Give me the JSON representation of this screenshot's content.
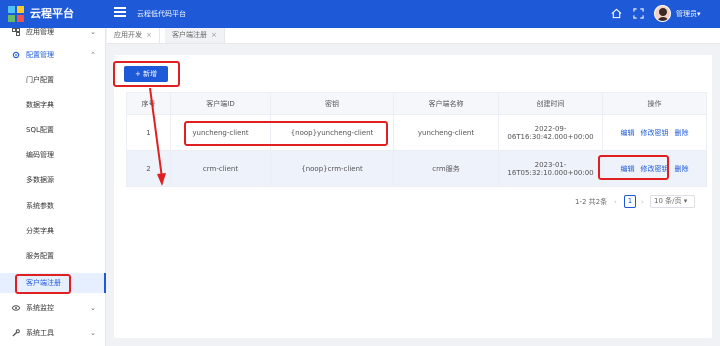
{
  "header": {
    "brand": "云程平台",
    "subtitle": "云程低代码平台",
    "user": "管理员▾",
    "accent_color": "#1e59d8"
  },
  "sidebar": {
    "items": [
      {
        "label": "应用管理",
        "icon": "app-icon",
        "chevron": "⌄"
      },
      {
        "label": "配置管理",
        "icon": "gear-icon",
        "chevron": "⌃"
      },
      {
        "label": "门户配置"
      },
      {
        "label": "数据字典"
      },
      {
        "label": "SQL配置"
      },
      {
        "label": "编码管理"
      },
      {
        "label": "多数据源"
      },
      {
        "label": "系统参数"
      },
      {
        "label": "分类字典"
      },
      {
        "label": "服务配置"
      },
      {
        "label": "客户端注册"
      },
      {
        "label": "系统监控",
        "icon": "eye-icon",
        "chevron": "⌄"
      },
      {
        "label": "系统工具",
        "icon": "wrench-icon",
        "chevron": "⌄"
      }
    ]
  },
  "tabs": [
    {
      "label": "应用开发",
      "close": "×"
    },
    {
      "label": "客户端注册",
      "close": "×"
    }
  ],
  "toolbar": {
    "add_label": "+ 新增"
  },
  "table": {
    "headers": [
      "序号",
      "客户端ID",
      "密钥",
      "客户端名称",
      "创建时间",
      "操作"
    ],
    "rows": [
      {
        "index": "1",
        "client_id": "yuncheng-client",
        "secret": "{noop}yuncheng-client",
        "name": "yuncheng-client",
        "created_line1": "2022-09-",
        "created_line2": "06T16:30:42.000+00:00"
      },
      {
        "index": "2",
        "client_id": "crm-client",
        "secret": "{noop}crm-client",
        "name": "crm服务",
        "created_line1": "2023-01-",
        "created_line2": "16T05:32:10.000+00:00"
      }
    ],
    "actions": {
      "edit": "编辑",
      "change_secret": "修改密钥",
      "delete": "删除"
    }
  },
  "pager": {
    "total": "1-2 共2条",
    "prev": "‹",
    "page": "1",
    "next": "›",
    "page_size": "10 条/页 ▾"
  },
  "highlight_color": "#e02020"
}
